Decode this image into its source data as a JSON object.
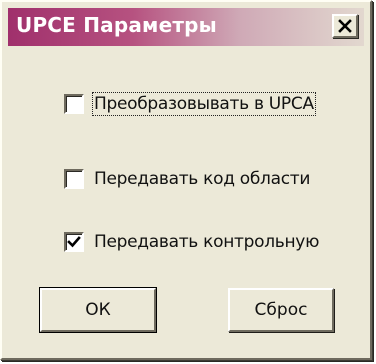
{
  "dialog": {
    "title": "UPCE Параметры",
    "close_icon": "close-icon"
  },
  "options": [
    {
      "label": "Преобразовывать в UPCA",
      "checked": false
    },
    {
      "label": "Передавать код области",
      "checked": false
    },
    {
      "label": "Передавать контрольную",
      "checked": true
    }
  ],
  "buttons": {
    "ok_label": "ОК",
    "reset_label": "Сброс"
  },
  "colors": {
    "face": "#ece9d8",
    "title_start": "#a0306c",
    "title_end": "#e2d8cf"
  }
}
